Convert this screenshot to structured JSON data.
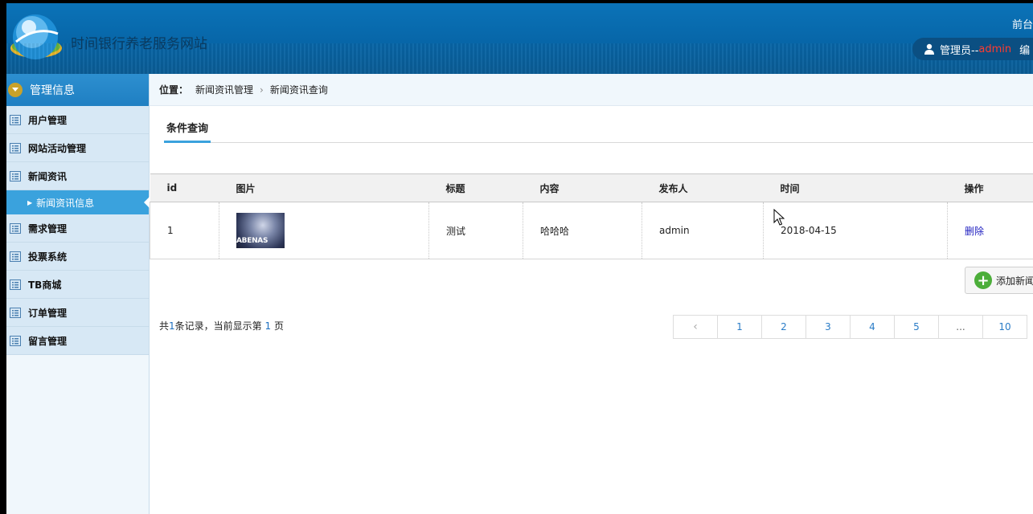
{
  "header": {
    "site_title": "时间银行养老服务网站",
    "top_link": "前台",
    "user_prefix": "管理员--",
    "user_name": "admin",
    "edit_label": "编"
  },
  "sidebar": {
    "head": "管理信息",
    "items": [
      {
        "label": "用户管理"
      },
      {
        "label": "网站活动管理"
      },
      {
        "label": "新闻资讯"
      },
      {
        "label": "新闻资讯信息",
        "sub": true
      },
      {
        "label": "需求管理"
      },
      {
        "label": "投票系统"
      },
      {
        "label": "TB商城"
      },
      {
        "label": "订单管理"
      },
      {
        "label": "留言管理"
      }
    ]
  },
  "breadcrumb": {
    "label": "位置：",
    "level1": "新闻资讯管理",
    "separator": "›",
    "level2": "新闻资讯查询"
  },
  "tab": "条件查询",
  "table": {
    "columns": [
      "id",
      "图片",
      "标题",
      "内容",
      "发布人",
      "时间",
      "操作"
    ],
    "rows": [
      {
        "id": "1",
        "image_text": "ABENAS",
        "title": "测试",
        "content": "哈哈哈",
        "publisher": "admin",
        "time": "2018-04-15",
        "action": "删除"
      }
    ]
  },
  "add_button": "添加新闻",
  "summary": {
    "pre": "共",
    "count": "1",
    "mid": "条记录，当前显示第",
    "page": "1",
    "post": "页"
  },
  "pager": {
    "prev": "‹",
    "pages": [
      "1",
      "2",
      "3",
      "4",
      "5",
      "...",
      "10"
    ]
  },
  "colors": {
    "header_blue": "#0766a8",
    "sidebar_active": "#3aa2dd",
    "link": "#2020c0",
    "user_red": "#ff3b30"
  }
}
